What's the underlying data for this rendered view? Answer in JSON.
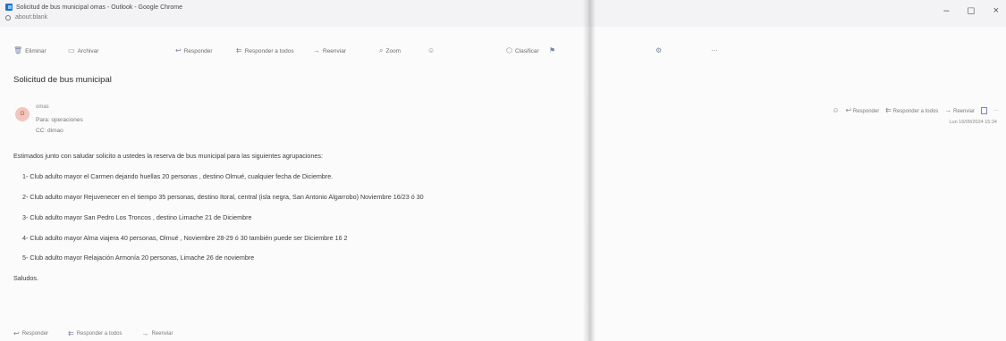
{
  "window": {
    "title": "Solicitud de bus municipal omas - Outlook - Google Chrome",
    "url": "about:blank",
    "controls": {
      "minimize": "–",
      "maximize": "◻",
      "close": "×"
    }
  },
  "toolbar": {
    "delete": "Eliminar",
    "archive": "Archivar",
    "reply": "Responder",
    "reply_all": "Responder a todos",
    "forward": "Reenviar",
    "zoom": "Zoom",
    "classify": "Clasificar"
  },
  "message": {
    "subject": "Solicitud de bus municipal",
    "sender": "omas",
    "avatar_initial": "O",
    "to_label": "Para:",
    "to": "operaciones",
    "cc_label": "CC:",
    "cc": "dimao",
    "date": "Lun 16/09/2024 15:34",
    "intro": "Estimados junto con saludar solicito a ustedes la reserva de bus municipal para las siguientes agrupaciones:",
    "items": [
      "1- Club adulto mayor el Carmen dejando huellas 20 personas , destino Olmué, cualquier fecha de Diciembre.",
      "2- Club adulto mayor Rejuvenecer en el tiempo  35 personas, destino Itoral, central (isla negra, San Antonio Algarrobo) Noviembre 16/23 ó 30",
      "3- Club adulto mayor San Pedro Los Troncos  , destino Limache 21 de Diciembre",
      "4- Club adulto mayor Alma viajera 40 personas, Olmué , Noviembre 28-29 ó 30 también puede ser Diciembre 16 2",
      "5- Club adulto mayor Relajación Armonía 20 personas, Limache 26 de noviembre"
    ],
    "closing": "Saludos."
  },
  "header_actions": {
    "reply": "Responder",
    "reply_all": "Responder a todos",
    "forward": "Reenviar",
    "more": "···"
  },
  "bottom_actions": {
    "reply": "Responder",
    "reply_all": "Responder a todos",
    "forward": "Reenviar"
  }
}
